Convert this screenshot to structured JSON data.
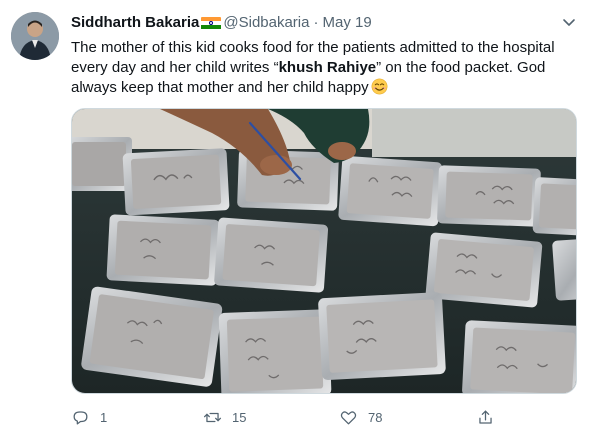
{
  "tweet": {
    "author": {
      "display_name": "Siddharth Bakaria",
      "flag_icon": "india-flag-emoji",
      "handle": "@Sidbakaria",
      "separator": "·",
      "date": "May 19"
    },
    "text": {
      "before_bold": "The mother of this kid cooks food for the patients admitted to the hospital every day and her child writes “",
      "bold": "khush Rahiye",
      "after_bold": "” on the food packet. God always keep that mother and her child happy",
      "emoji": "smiling-face-with-smiling-eyes"
    },
    "more_icon": "chevron-down-icon",
    "media": {
      "description_icon": "photo",
      "packet_scribble": "खुश रहिए"
    },
    "actions": {
      "reply_count": "1",
      "retweet_count": "15",
      "like_count": "78",
      "share_label": ""
    },
    "colors": {
      "text": "#0f1419",
      "secondary": "#536471",
      "border": "#cfd9de"
    }
  }
}
